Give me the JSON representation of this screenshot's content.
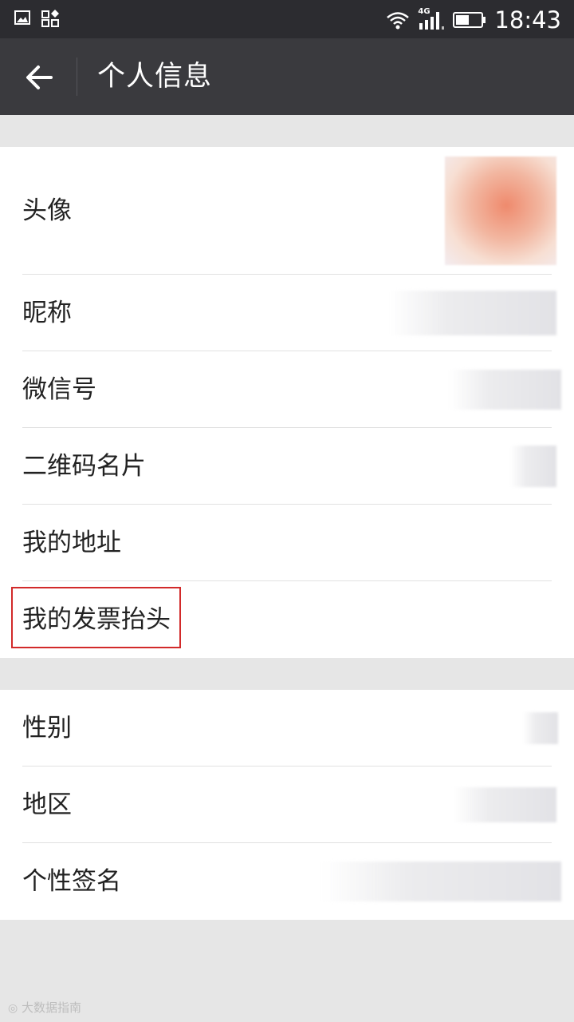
{
  "status_bar": {
    "time": "18:43",
    "network": "4G"
  },
  "app_bar": {
    "title": "个人信息"
  },
  "profile": {
    "rows": [
      {
        "label": "头像"
      },
      {
        "label": "昵称"
      },
      {
        "label": "微信号"
      },
      {
        "label": "二维码名片"
      },
      {
        "label": "我的地址"
      },
      {
        "label": "我的发票抬头"
      }
    ]
  },
  "details": {
    "rows": [
      {
        "label": "性别"
      },
      {
        "label": "地区"
      },
      {
        "label": "个性签名"
      }
    ]
  },
  "watermark": "大数据指南",
  "colors": {
    "status_bar_bg": "#2c2c30",
    "app_bar_bg": "#3a3a3e",
    "page_bg": "#e6e6e6",
    "highlight_border": "#d22a2a"
  }
}
